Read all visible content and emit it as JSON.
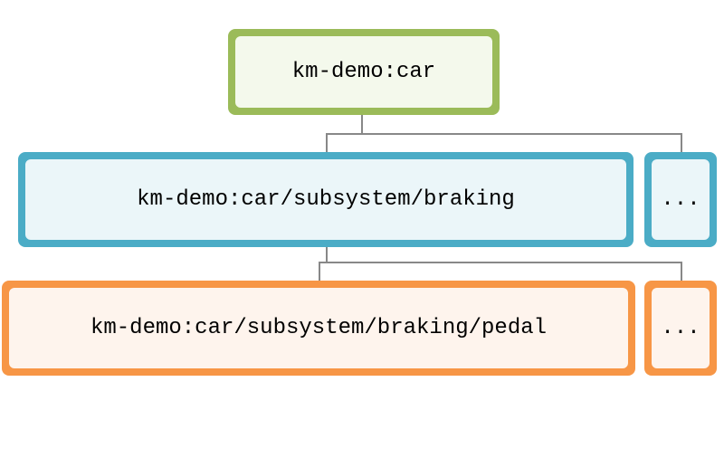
{
  "nodes": {
    "root": {
      "label": "km-demo:car",
      "color": "#9bbb59",
      "level": 0
    },
    "subsystem_braking": {
      "label": "km-demo:car/subsystem/braking",
      "color": "#4bacc6",
      "level": 1
    },
    "subsystem_more": {
      "label": "...",
      "color": "#4bacc6",
      "level": 1
    },
    "pedal": {
      "label": "km-demo:car/subsystem/braking/pedal",
      "color": "#f79646",
      "level": 2
    },
    "pedal_more": {
      "label": "...",
      "color": "#f79646",
      "level": 2
    }
  },
  "colors": {
    "level0_border": "#9bbb59",
    "level0_fill": "#f4f9ec",
    "level1_border": "#4bacc6",
    "level1_fill": "#ebf6f9",
    "level2_border": "#f79646",
    "level2_fill": "#fef4ed"
  }
}
